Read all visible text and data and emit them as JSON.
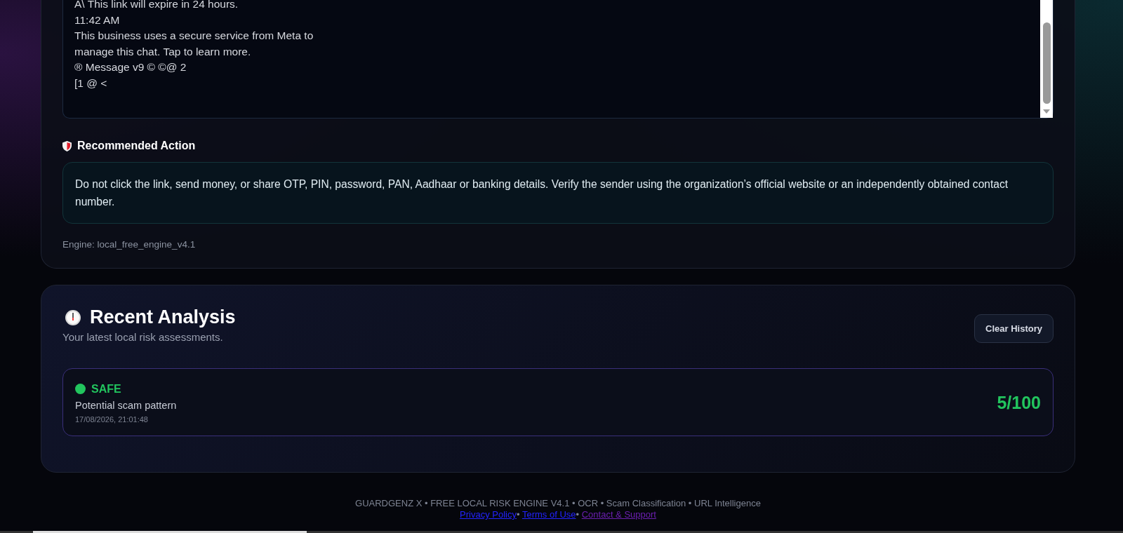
{
  "message_text": {
    "lines": [
      "A\\ This link will expire in 24 hours.",
      "11:42 AM",
      "This business uses a secure service from Meta to",
      "manage this chat. Tap to learn more.",
      "® Message v9 © ©@ 2",
      "[1 @ <"
    ]
  },
  "recommended_action": {
    "title": "Recommended Action",
    "text": "Do not click the link, send money, or share OTP, PIN, password, PAN, Aadhaar or banking details. Verify the sender using the organization’s official website or an independently obtained contact number."
  },
  "engine": "Engine: local_free_engine_v4.1",
  "recent_analysis": {
    "title": "Recent Analysis",
    "subtitle": "Your latest local risk assessments.",
    "clear_button": "Clear History",
    "items": [
      {
        "status": "SAFE",
        "color": "#22c55e",
        "summary": "Potential scam pattern",
        "timestamp": "17/08/2026, 21:01:48",
        "score": "5/100"
      }
    ]
  },
  "footer": {
    "text": "GUARDGENZ X • FREE LOCAL RISK ENGINE V4.1 • OCR • Scam Classification • URL Intelligence",
    "separator": "•",
    "links": [
      {
        "label": "Privacy Policy",
        "visited": false
      },
      {
        "label": "Terms of Use",
        "visited": false
      },
      {
        "label": "Contact & Support",
        "visited": true
      }
    ]
  }
}
